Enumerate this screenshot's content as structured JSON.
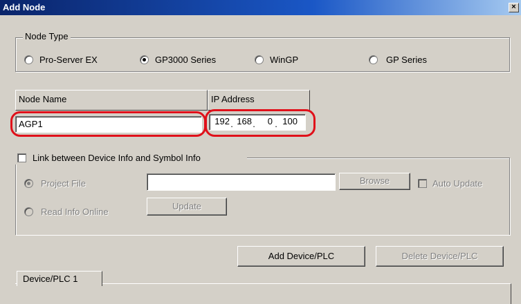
{
  "window": {
    "title": "Add Node",
    "close_glyph": "×"
  },
  "node_type": {
    "legend": "Node Type",
    "options": [
      {
        "label": "Pro-Server EX",
        "checked": false
      },
      {
        "label": "GP3000 Series",
        "checked": true
      },
      {
        "label": "WinGP",
        "checked": false
      },
      {
        "label": "GP Series",
        "checked": false
      }
    ]
  },
  "node_name": {
    "header": "Node Name",
    "value": "AGP1"
  },
  "ip_address": {
    "header": "IP Address",
    "octets": [
      "192",
      "168",
      "0",
      "100"
    ],
    "separator": "."
  },
  "link": {
    "label": "Link between Device Info and Symbol Info",
    "checked": false,
    "project_file_label": "Project File",
    "project_file_value": "",
    "browse_label": "Browse",
    "auto_update_label": "Auto Update",
    "read_online_label": "Read Info Online",
    "update_label": "Update"
  },
  "buttons": {
    "add_device": "Add Device/PLC",
    "delete_device": "Delete Device/PLC"
  },
  "tabs": [
    {
      "label": "Device/PLC 1"
    }
  ],
  "colors": {
    "highlight": "#e0101a",
    "titlebar": "#0a246a"
  }
}
